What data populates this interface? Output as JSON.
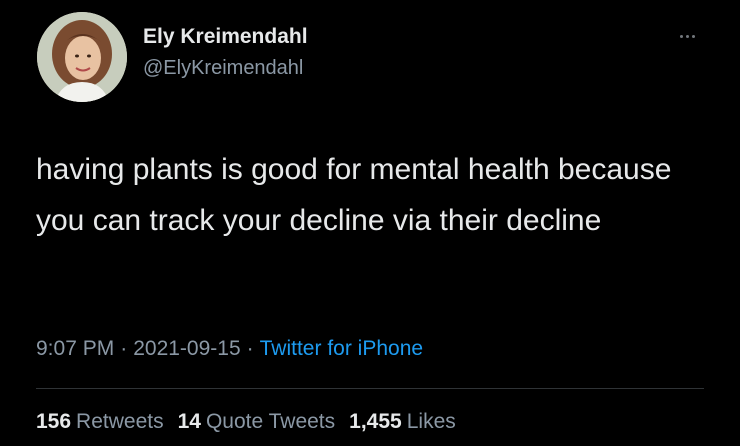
{
  "user": {
    "display_name": "Ely Kreimendahl",
    "handle": "@ElyKreimendahl",
    "avatar_icon": "profile-photo"
  },
  "tweet": {
    "text": "having plants is good for mental health because you can track your decline via their decline",
    "time": "9:07 PM",
    "date": "2021-09-15",
    "separator": "·",
    "source": "Twitter for iPhone"
  },
  "stats": {
    "retweets_count": "156",
    "retweets_label": "Retweets",
    "quote_count": "14",
    "quote_label": "Quote Tweets",
    "likes_count": "1,455",
    "likes_label": "Likes"
  },
  "colors": {
    "background": "#000000",
    "text": "#e7e9ea",
    "secondary": "#8b98a5",
    "link": "#1d9bf0"
  },
  "icons": {
    "more": "more-horizontal-icon"
  }
}
